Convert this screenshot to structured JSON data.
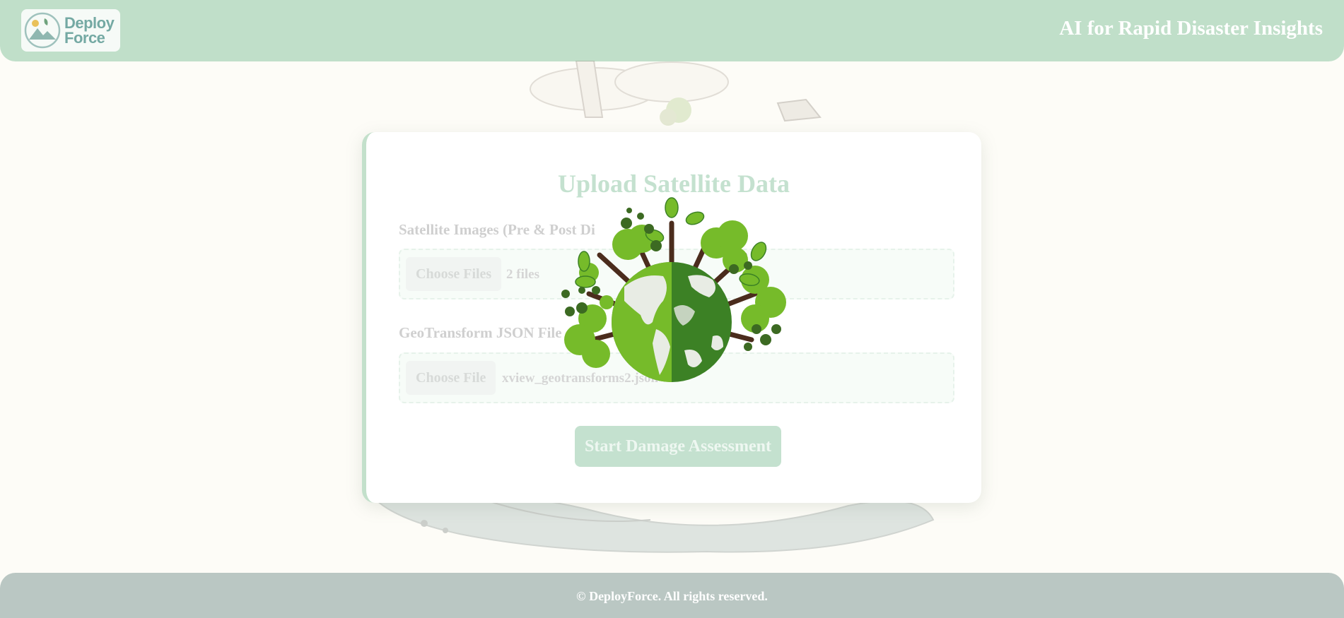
{
  "header": {
    "logo": {
      "line1": "Deploy",
      "line2": "Force"
    },
    "tagline": "AI for Rapid Disaster Insights"
  },
  "upload_card": {
    "title": "Upload Satellite Data",
    "images_field": {
      "label": "Satellite Images (Pre & Post Di",
      "button_label": "Choose Files",
      "value": "2 files"
    },
    "geo_field": {
      "label": "GeoTransform JSON File",
      "button_label": "Choose File",
      "value": "xview_geotransforms2.json"
    },
    "submit_label": "Start Damage Assessment"
  },
  "loader": {
    "icon": "globe-trees-icon"
  },
  "footer": {
    "copyright": "© DeployForce. All rights reserved."
  },
  "colors": {
    "header_bg": "#c0dfc9",
    "footer_bg": "#bac7c3",
    "page_bg": "#fdfcf7",
    "accent": "#c4e1cf",
    "leaf_green": "#76bb2a",
    "dark_green": "#3c8125"
  }
}
